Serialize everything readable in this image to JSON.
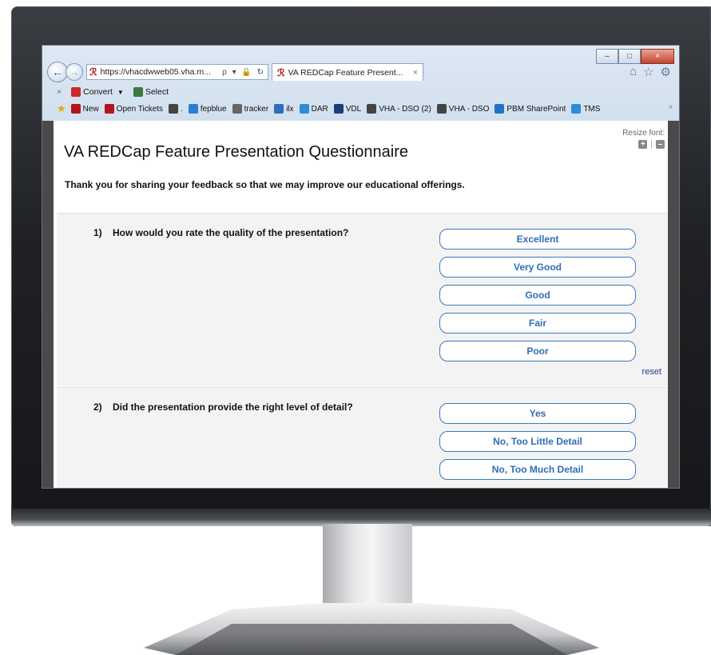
{
  "browser": {
    "address": "https://vhacdwweb05.vha.m...",
    "address_tools": "ρ ▾ 🔒 ↻",
    "tab_title": "VA REDCap Feature Present...",
    "tab_close": "×",
    "window_buttons": [
      "–",
      "□",
      "×"
    ],
    "right_icons": [
      "home-icon",
      "star-icon",
      "gear-icon"
    ],
    "command_bar": {
      "close": "×",
      "convert": "Convert",
      "select": "Select"
    },
    "favorites": [
      {
        "label": "New",
        "icon": "redcap-icon",
        "color": "#b2161b"
      },
      {
        "label": "Open Tickets",
        "icon": "redcap-icon",
        "color": "#b2161b"
      },
      {
        "label": ".",
        "icon": "w-icon",
        "color": "#444444"
      },
      {
        "label": "fepblue",
        "icon": "cross-icon",
        "color": "#2a7fd4"
      },
      {
        "label": "tracker",
        "icon": "tracker-icon",
        "color": "#666666"
      },
      {
        "label": "ilx",
        "icon": "shield-icon",
        "color": "#2f6db6"
      },
      {
        "label": "DAR",
        "icon": "ie-icon",
        "color": "#2f8bd6"
      },
      {
        "label": "VDL",
        "icon": "va-icon",
        "color": "#1a3f7a"
      },
      {
        "label": "VHA - DSO (2)",
        "icon": "cloud-icon",
        "color": "#444444"
      },
      {
        "label": "VHA - DSO",
        "icon": "cloud-icon",
        "color": "#444444"
      },
      {
        "label": "PBM SharePoint",
        "icon": "sharepoint-icon",
        "color": "#1f74c4"
      },
      {
        "label": "TMS",
        "icon": "ie-icon",
        "color": "#2f8bd6"
      }
    ],
    "favorites_overflow": "»"
  },
  "survey": {
    "title": "VA REDCap Feature Presentation Questionnaire",
    "resize_label": "Resize font:",
    "resize_plus": "+",
    "resize_sep": "|",
    "resize_minus": "–",
    "intro": "Thank you for sharing your feedback so that we may improve our educational offerings.",
    "questions": [
      {
        "number": "1)",
        "text": "How would you rate the quality of the presentation?",
        "options": [
          "Excellent",
          "Very Good",
          "Good",
          "Fair",
          "Poor"
        ],
        "reset": "reset"
      },
      {
        "number": "2)",
        "text": "Did the presentation provide the right level of detail?",
        "options": [
          "Yes",
          "No, Too Little Detail",
          "No, Too Much Detail"
        ]
      }
    ]
  },
  "colors": {
    "option_border": "#3b79c2",
    "option_text": "#2f6db6",
    "redcap_red": "#b2161b"
  }
}
